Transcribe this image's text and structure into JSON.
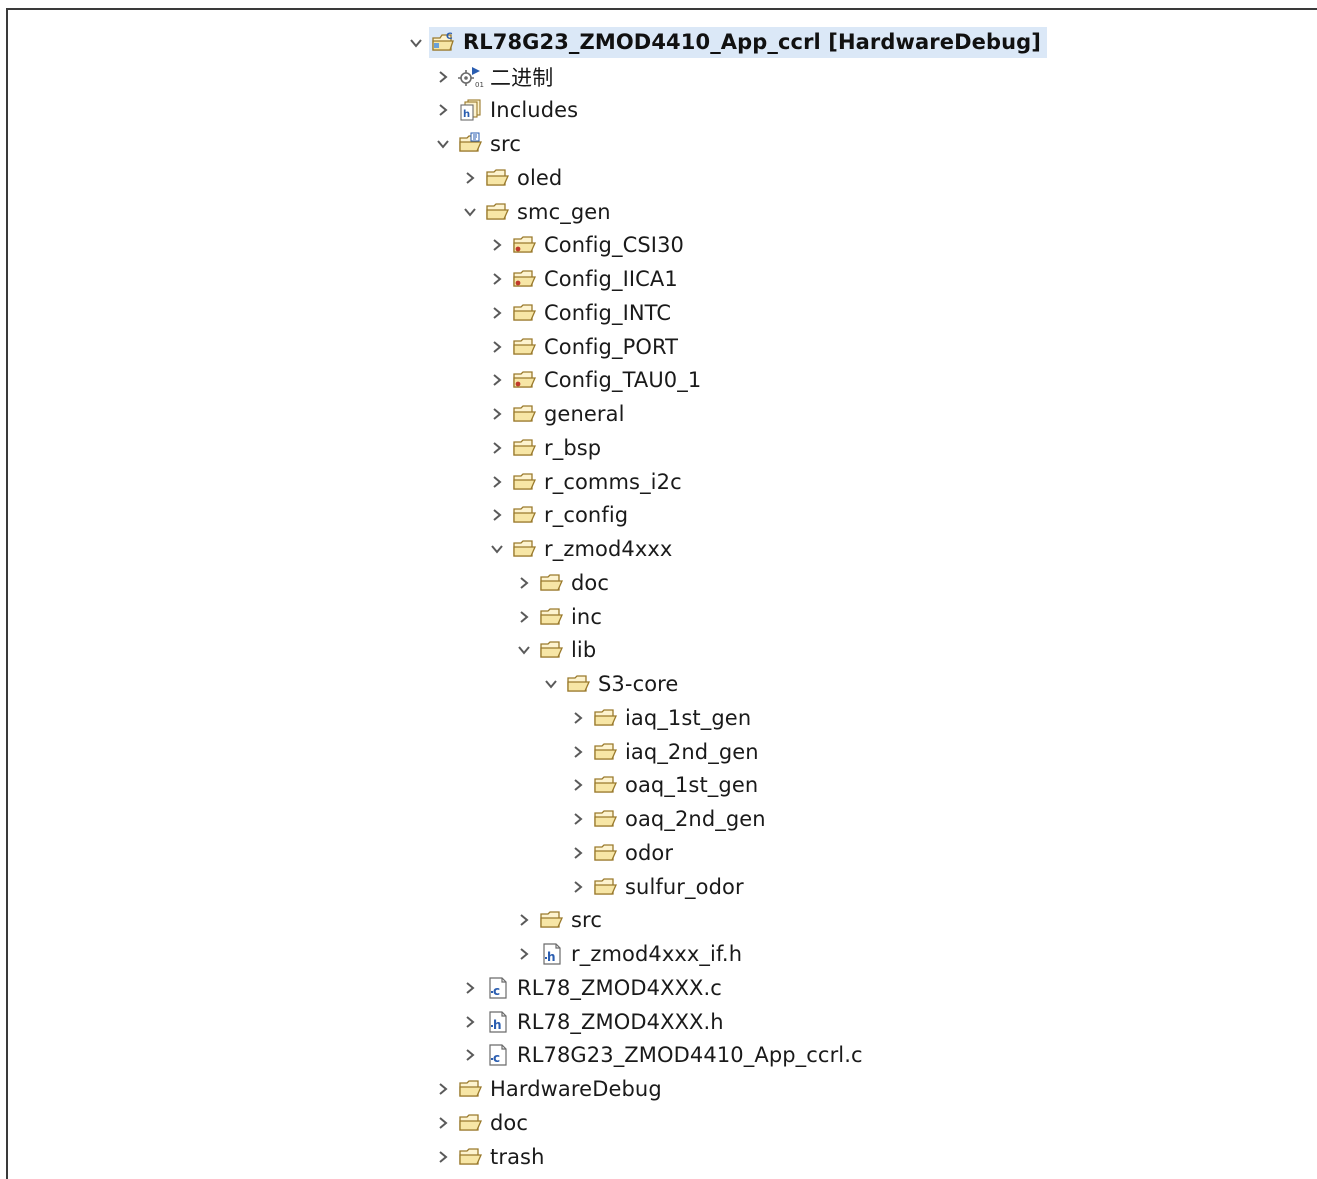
{
  "tree": {
    "root": {
      "label": "RL78G23_ZMOD4410_App_ccrl [HardwareDebug]",
      "expanded": true,
      "icon": "c-project-icon"
    },
    "items": [
      {
        "label": "二进制",
        "depth": 1,
        "expanded": false,
        "icon": "binaries-icon",
        "name": "binaries"
      },
      {
        "label": "Includes",
        "depth": 1,
        "expanded": false,
        "icon": "includes-icon",
        "name": "includes"
      },
      {
        "label": "src",
        "depth": 1,
        "expanded": true,
        "icon": "source-folder-icon",
        "name": "src"
      },
      {
        "label": "oled",
        "depth": 2,
        "expanded": false,
        "icon": "folder-icon",
        "name": "oled"
      },
      {
        "label": "smc_gen",
        "depth": 2,
        "expanded": true,
        "icon": "folder-icon",
        "name": "smc-gen"
      },
      {
        "label": "Config_CSI30",
        "depth": 3,
        "expanded": false,
        "icon": "config-folder-icon",
        "name": "config-csi30"
      },
      {
        "label": "Config_IICA1",
        "depth": 3,
        "expanded": false,
        "icon": "config-folder-icon",
        "name": "config-iica1"
      },
      {
        "label": "Config_INTC",
        "depth": 3,
        "expanded": false,
        "icon": "folder-icon",
        "name": "config-intc"
      },
      {
        "label": "Config_PORT",
        "depth": 3,
        "expanded": false,
        "icon": "folder-icon",
        "name": "config-port"
      },
      {
        "label": "Config_TAU0_1",
        "depth": 3,
        "expanded": false,
        "icon": "config-folder-icon",
        "name": "config-tau0-1"
      },
      {
        "label": "general",
        "depth": 3,
        "expanded": false,
        "icon": "folder-icon",
        "name": "general"
      },
      {
        "label": "r_bsp",
        "depth": 3,
        "expanded": false,
        "icon": "folder-icon",
        "name": "r-bsp"
      },
      {
        "label": "r_comms_i2c",
        "depth": 3,
        "expanded": false,
        "icon": "folder-icon",
        "name": "r-comms-i2c"
      },
      {
        "label": "r_config",
        "depth": 3,
        "expanded": false,
        "icon": "folder-icon",
        "name": "r-config"
      },
      {
        "label": "r_zmod4xxx",
        "depth": 3,
        "expanded": true,
        "icon": "folder-icon",
        "name": "r-zmod4xxx"
      },
      {
        "label": "doc",
        "depth": 4,
        "expanded": false,
        "icon": "folder-icon",
        "name": "doc-inner"
      },
      {
        "label": "inc",
        "depth": 4,
        "expanded": false,
        "icon": "folder-icon",
        "name": "inc"
      },
      {
        "label": "lib",
        "depth": 4,
        "expanded": true,
        "icon": "folder-icon",
        "name": "lib"
      },
      {
        "label": "S3-core",
        "depth": 5,
        "expanded": true,
        "icon": "folder-icon",
        "name": "s3-core"
      },
      {
        "label": "iaq_1st_gen",
        "depth": 6,
        "expanded": false,
        "icon": "folder-icon",
        "name": "iaq-1st-gen"
      },
      {
        "label": "iaq_2nd_gen",
        "depth": 6,
        "expanded": false,
        "icon": "folder-icon",
        "name": "iaq-2nd-gen"
      },
      {
        "label": "oaq_1st_gen",
        "depth": 6,
        "expanded": false,
        "icon": "folder-icon",
        "name": "oaq-1st-gen"
      },
      {
        "label": "oaq_2nd_gen",
        "depth": 6,
        "expanded": false,
        "icon": "folder-icon",
        "name": "oaq-2nd-gen"
      },
      {
        "label": "odor",
        "depth": 6,
        "expanded": false,
        "icon": "folder-icon",
        "name": "odor"
      },
      {
        "label": "sulfur_odor",
        "depth": 6,
        "expanded": false,
        "icon": "folder-icon",
        "name": "sulfur-odor"
      },
      {
        "label": "src",
        "depth": 4,
        "expanded": false,
        "icon": "folder-icon",
        "name": "src-inner"
      },
      {
        "label": "r_zmod4xxx_if.h",
        "depth": 4,
        "expanded": false,
        "icon": "h-file-icon",
        "name": "r-zmod4xxx-if-h"
      },
      {
        "label": "RL78_ZMOD4XXX.c",
        "depth": 2,
        "expanded": false,
        "icon": "c-file-icon",
        "name": "rl78-zmod4xxx-c"
      },
      {
        "label": "RL78_ZMOD4XXX.h",
        "depth": 2,
        "expanded": false,
        "icon": "h-file-icon",
        "name": "rl78-zmod4xxx-h"
      },
      {
        "label": "RL78G23_ZMOD4410_App_ccrl.c",
        "depth": 2,
        "expanded": false,
        "icon": "c-file-icon",
        "name": "rl78g23-app-c"
      },
      {
        "label": "HardwareDebug",
        "depth": 1,
        "expanded": false,
        "icon": "folder-icon",
        "name": "hardware-debug"
      },
      {
        "label": "doc",
        "depth": 1,
        "expanded": false,
        "icon": "folder-icon",
        "name": "doc"
      },
      {
        "label": "trash",
        "depth": 1,
        "expanded": false,
        "icon": "folder-icon",
        "name": "trash"
      }
    ]
  },
  "colors": {
    "selection": "#dbe8f7",
    "folder_fill": "#fdf3cf",
    "folder_stroke": "#9a7a2c",
    "chevron": "#5a5a5a",
    "text": "#1a1a1a"
  }
}
